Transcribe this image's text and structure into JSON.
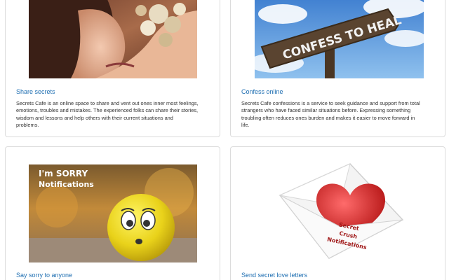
{
  "cards": [
    {
      "title": "Share secrets",
      "desc_lines": [
        "Secrets Cafe is an online space to share and vent out ones inner most feelings,",
        "emotions, troubles and mistakes. The experienced folks can share their stories,",
        "wisdom and lessons and help others with their current situations and",
        "problems."
      ]
    },
    {
      "title": "Confess online",
      "image_text": "CONFESS TO HEAL",
      "desc_lines": [
        "Secrets Cafe confessions is a service to seek guidance and support from total",
        "strangers who have faced similar situations before. Expressing something",
        "troubling often reduces ones burden and makes it easier to move forward in",
        "life."
      ]
    },
    {
      "title": "Say sorry to anyone",
      "image_text_line1": "I'm SORRY",
      "image_text_line2": "Notifications"
    },
    {
      "title": "Send secret love letters",
      "image_text_line1": "Secret",
      "image_text_line2": "Crush",
      "image_text_line3": "Notifications"
    }
  ],
  "colors": {
    "link": "#1f6fb2",
    "body_text": "#333333",
    "card_border": "#dcdcdc"
  }
}
